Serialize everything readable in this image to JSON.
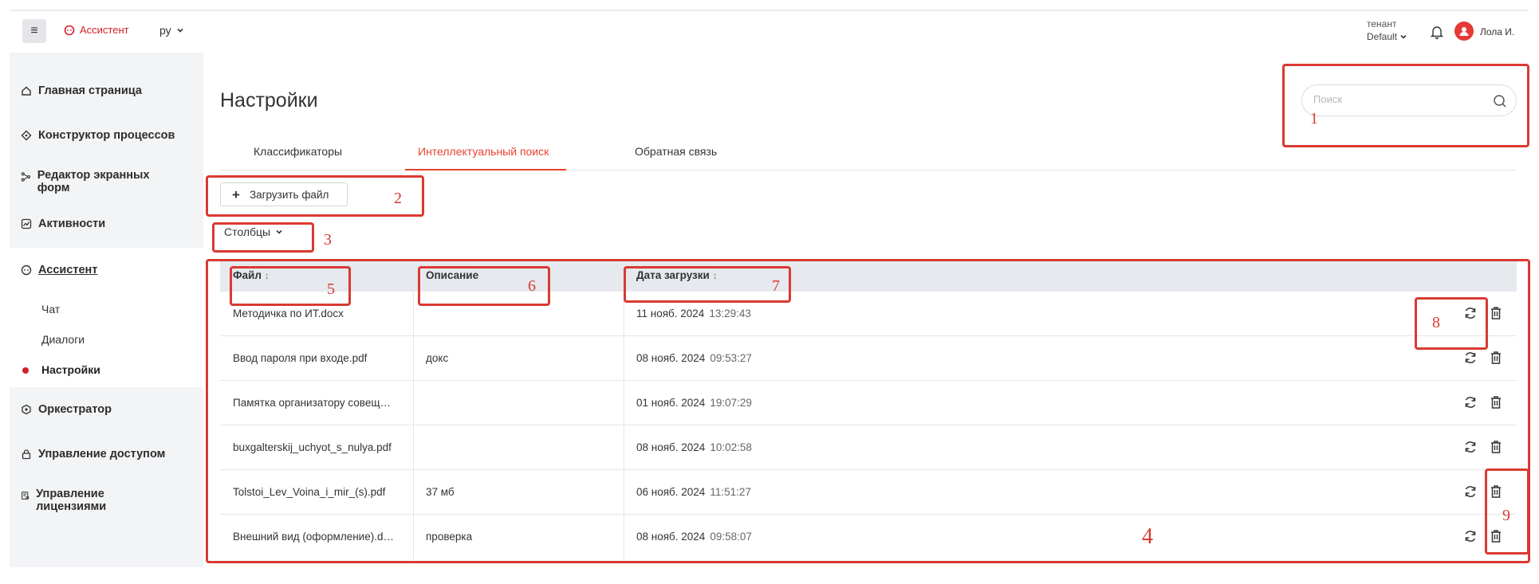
{
  "header": {
    "brand": "Ассистент",
    "lang": "ру",
    "tenant_label": "тенант",
    "tenant_value": "Default",
    "user_name": "Лола И."
  },
  "sidebar": {
    "items": [
      {
        "label": "Главная страница",
        "icon": "home-icon"
      },
      {
        "label": "Конструктор процессов",
        "icon": "process-icon"
      },
      {
        "label": "Редактор экранных форм",
        "icon": "form-editor-icon"
      },
      {
        "label": "Активности",
        "icon": "activity-icon"
      },
      {
        "label": "Ассистент",
        "icon": "assistant-icon"
      },
      {
        "label": "Оркестратор",
        "icon": "orchestrator-icon"
      },
      {
        "label": "Управление доступом",
        "icon": "access-icon"
      },
      {
        "label": "Управление лицензиями",
        "icon": "license-icon"
      }
    ],
    "assistant_sub": [
      {
        "label": "Чат"
      },
      {
        "label": "Диалоги"
      },
      {
        "label": "Настройки"
      }
    ]
  },
  "page": {
    "title": "Настройки",
    "search_placeholder": "Поиск"
  },
  "tabs": [
    {
      "label": "Классификаторы"
    },
    {
      "label": "Интеллектуальный поиск"
    },
    {
      "label": "Обратная связь"
    }
  ],
  "toolbar": {
    "upload_label": "Загрузить файл",
    "columns_label": "Столбцы"
  },
  "table": {
    "columns": [
      "Файл",
      "Описание",
      "Дата загрузки"
    ],
    "rows": [
      {
        "file": "Методичка по ИТ.docx",
        "desc": "",
        "date": "11 нояб. 2024",
        "time": "13:29:43"
      },
      {
        "file": "Ввод пароля при входе.pdf",
        "desc": "докс",
        "date": "08 нояб. 2024",
        "time": "09:53:27"
      },
      {
        "file": "Памятка организатору совещаний",
        "desc": "",
        "date": "01 нояб. 2024",
        "time": "19:07:29"
      },
      {
        "file": "buxgalterskij_uchyot_s_nulya.pdf",
        "desc": "",
        "date": "08 нояб. 2024",
        "time": "10:02:58"
      },
      {
        "file": "Tolstoi_Lev_Voina_i_mir_(s).pdf",
        "desc": "37 мб",
        "date": "06 нояб. 2024",
        "time": "11:51:27"
      },
      {
        "file": "Внешний вид (оформление).docx",
        "desc": "проверка",
        "date": "08 нояб. 2024",
        "time": "09:58:07"
      }
    ]
  },
  "annotations": [
    "1",
    "2",
    "3",
    "4",
    "5",
    "6",
    "7",
    "8",
    "9"
  ],
  "colors": {
    "accent": "#e8412f",
    "brand": "#d4202a",
    "annotation": "#d93a32"
  }
}
